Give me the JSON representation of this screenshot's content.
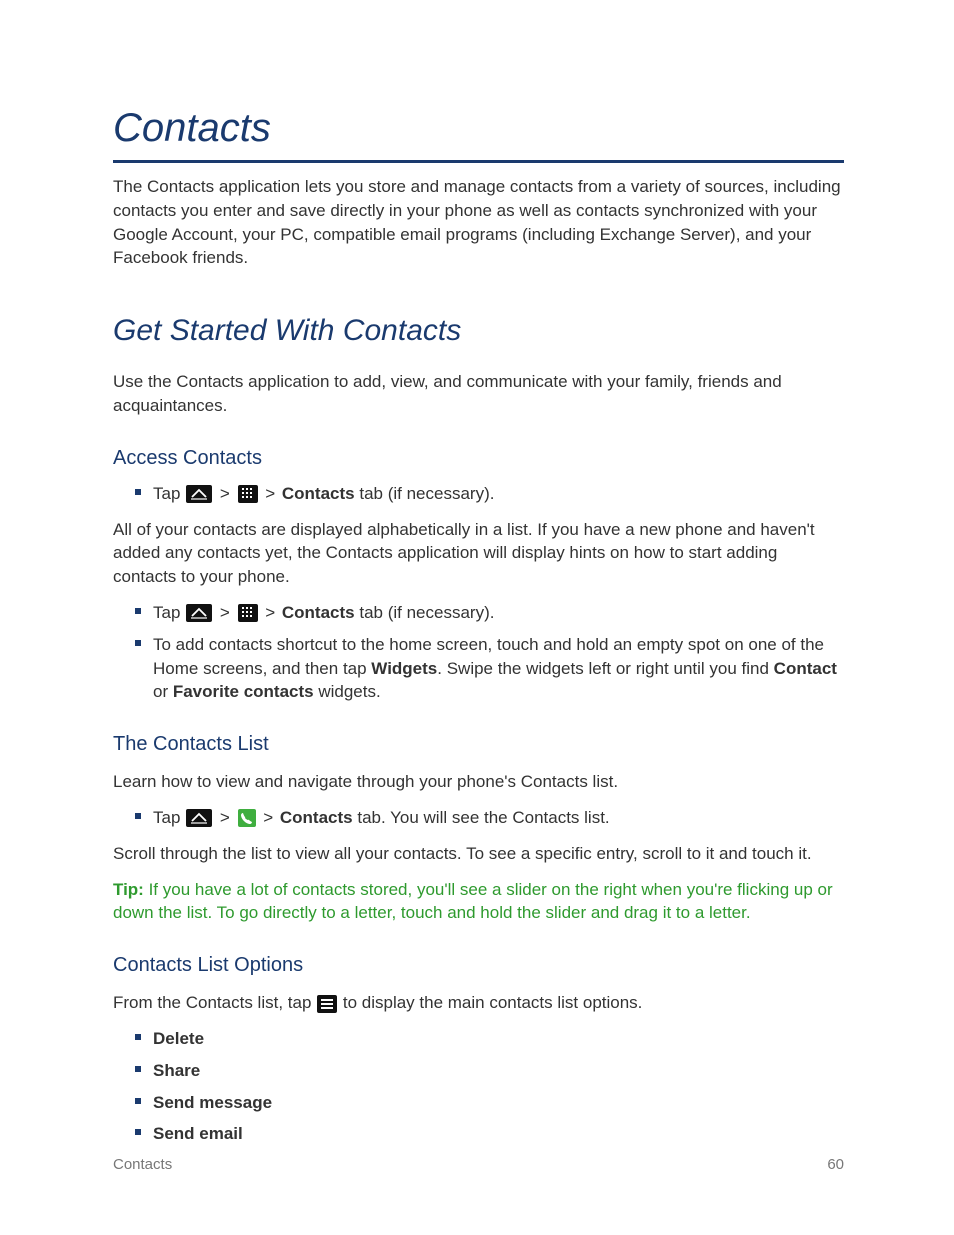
{
  "title": "Contacts",
  "intro": "The Contacts application lets you store and manage contacts from a variety of sources, including contacts you enter and save directly in your phone as well as contacts synchronized with your Google Account, your PC, compatible email programs (including Exchange Server), and your Facebook friends.",
  "section1": {
    "heading": "Get Started With Contacts",
    "intro": "Use the Contacts application to add, view, and communicate with your family, friends and acquaintances.",
    "sub1": {
      "heading": "Access Contacts",
      "tap_prefix": "Tap ",
      "sep": " > ",
      "contacts_bold": "Contacts",
      "tab_suffix": " tab (if necessary).",
      "para": "All of your contacts are displayed alphabetically in a list. If you have a new phone and haven't added any contacts yet, the Contacts application will display hints on how to start adding contacts to your phone.",
      "li2_prefix": "To add contacts shortcut to the home screen, touch and hold an empty spot on one of the Home screens, and then tap ",
      "li2_bold1": "Widgets",
      "li2_mid": ". Swipe the widgets left or right until you find ",
      "li2_bold2": "Contact",
      "li2_or": " or ",
      "li2_bold3": "Favorite contacts",
      "li2_suffix": " widgets."
    },
    "sub2": {
      "heading": "The Contacts List",
      "intro": "Learn how to view and navigate through your phone's Contacts list.",
      "tap_prefix": "Tap ",
      "sep": " > ",
      "contacts_bold": "Contacts",
      "tab_suffix": " tab. You will see the Contacts list.",
      "para2": "Scroll through the list to view all your contacts. To see a specific entry, scroll to it and touch it.",
      "tip_label": "Tip:",
      "tip_body": "  If you have a lot of contacts stored, you'll see a slider on the right when you're flicking up or down the list. To go directly to a letter, touch and hold the slider and drag it to a letter."
    },
    "sub3": {
      "heading": "Contacts List Options",
      "intro_prefix": "From the Contacts list, tap ",
      "intro_suffix": " to display the main contacts list options.",
      "options": [
        "Delete",
        "Share",
        "Send message",
        "Send email"
      ]
    }
  },
  "footer": {
    "left": "Contacts",
    "right": "60"
  }
}
